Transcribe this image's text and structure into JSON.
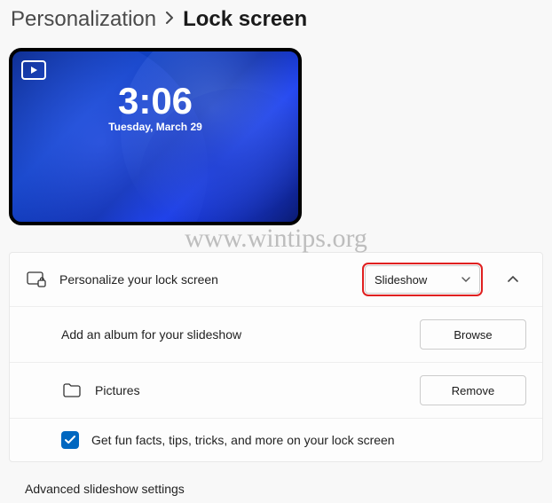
{
  "breadcrumb": {
    "parent": "Personalization",
    "current": "Lock screen"
  },
  "preview": {
    "time": "3:06",
    "date": "Tuesday, March 29"
  },
  "personalize": {
    "label": "Personalize your lock screen",
    "select_value": "Slideshow"
  },
  "album": {
    "label": "Add an album for your slideshow",
    "browse": "Browse"
  },
  "folder": {
    "name": "Pictures",
    "remove": "Remove"
  },
  "funfacts": {
    "label": "Get fun facts, tips, tricks, and more on your lock screen",
    "checked": true
  },
  "advanced": {
    "label": "Advanced slideshow settings"
  },
  "watermark": "www.wintips.org"
}
